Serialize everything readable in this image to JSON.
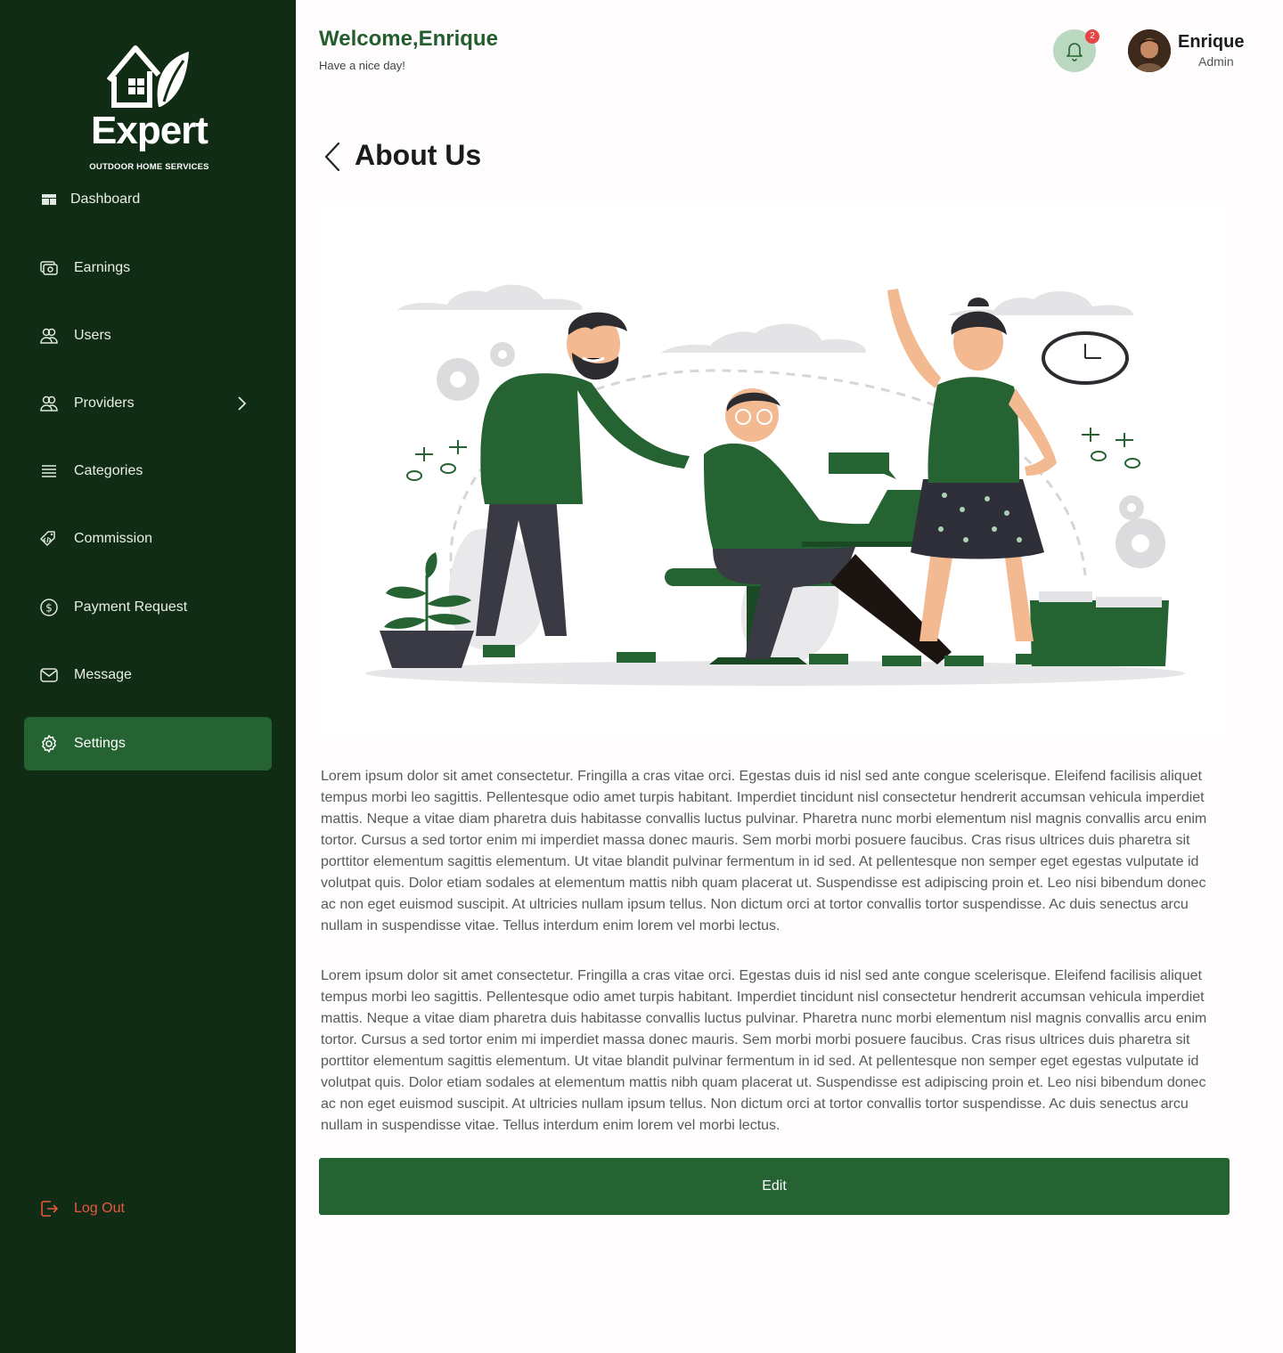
{
  "brand": {
    "name": "Expert",
    "tagline": "OUTDOOR HOME SERVICES"
  },
  "sidebar": {
    "items": [
      {
        "label": "Dashboard",
        "icon": "dashboard-icon"
      },
      {
        "label": "Earnings",
        "icon": "earnings-icon"
      },
      {
        "label": "Users",
        "icon": "users-icon"
      },
      {
        "label": "Providers",
        "icon": "providers-icon"
      },
      {
        "label": "Categories",
        "icon": "categories-icon"
      },
      {
        "label": "Commission",
        "icon": "commission-icon"
      },
      {
        "label": "Payment Request",
        "icon": "payment-icon"
      },
      {
        "label": "Message",
        "icon": "message-icon"
      },
      {
        "label": "Settings",
        "icon": "settings-icon",
        "active": true
      }
    ],
    "logout": "Log Out"
  },
  "header": {
    "welcome": "Welcome,Enrique",
    "subtitle": "Have a nice day!",
    "notification_count": "2",
    "user_name": "Enrique",
    "user_role": "Admin"
  },
  "page": {
    "title": "About Us",
    "paragraphs": [
      "Lorem ipsum dolor sit amet consectetur. Fringilla a cras vitae orci. Egestas duis id nisl sed ante congue scelerisque. Eleifend facilisis aliquet tempus morbi leo sagittis. Pellentesque odio amet turpis habitant. Imperdiet tincidunt nisl consectetur hendrerit accumsan vehicula imperdiet mattis. Neque a vitae diam pharetra duis habitasse convallis luctus pulvinar. Pharetra nunc morbi elementum nisl magnis convallis arcu enim tortor. Cursus a sed tortor enim mi imperdiet massa donec mauris. Sem morbi morbi posuere faucibus. Cras risus ultrices duis pharetra sit porttitor elementum sagittis elementum. Ut vitae blandit pulvinar fermentum in id sed. At pellentesque non semper eget egestas vulputate id volutpat quis. Dolor etiam sodales at elementum mattis nibh quam placerat ut. Suspendisse est adipiscing proin et. Leo nisi bibendum donec ac non eget euismod suscipit. At ultricies nullam ipsum tellus. Non dictum orci at tortor convallis tortor suspendisse. Ac duis senectus arcu nullam in suspendisse vitae. Tellus interdum enim lorem vel morbi lectus.",
      "Lorem ipsum dolor sit amet consectetur. Fringilla a cras vitae orci. Egestas duis id nisl sed ante congue scelerisque. Eleifend facilisis aliquet tempus morbi leo sagittis. Pellentesque odio amet turpis habitant. Imperdiet tincidunt nisl consectetur hendrerit accumsan vehicula imperdiet mattis. Neque a vitae diam pharetra duis habitasse convallis luctus pulvinar. Pharetra nunc morbi elementum nisl magnis convallis arcu enim tortor. Cursus a sed tortor enim mi imperdiet massa donec mauris. Sem morbi morbi posuere faucibus. Cras risus ultrices duis pharetra sit porttitor elementum sagittis elementum. Ut vitae blandit pulvinar fermentum in id sed. At pellentesque non semper eget egestas vulputate id volutpat quis. Dolor etiam sodales at elementum mattis nibh quam placerat ut. Suspendisse est adipiscing proin et. Leo nisi bibendum donec ac non eget euismod suscipit. At ultricies nullam ipsum tellus. Non dictum orci at tortor convallis tortor suspendisse. Ac duis senectus arcu nullam in suspendisse vitae. Tellus interdum enim lorem vel morbi lectus."
    ],
    "edit_label": "Edit"
  },
  "colors": {
    "sidebar_bg": "#112c15",
    "accent": "#256332",
    "logout": "#e9573f",
    "badge": "#e54545"
  }
}
